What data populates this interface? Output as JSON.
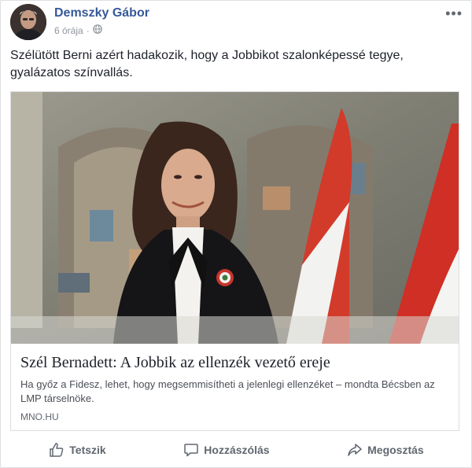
{
  "post": {
    "author": "Demszky Gábor",
    "time": "6 órája",
    "separator": "·",
    "message": "Szélütött Berni azért hadakozik, hogy a Jobbikot szalonképessé tegye, gyalázatos színvallás.",
    "more_label": "•••"
  },
  "link": {
    "title": "Szél Bernadett: A Jobbik az ellenzék vezető ereje",
    "description": "Ha győz a Fidesz, lehet, hogy megsemmisítheti a jelenlegi ellenzéket – mondta Bécsben az LMP társelnöke.",
    "domain": "MNO.HU"
  },
  "actions": {
    "like": "Tetszik",
    "comment": "Hozzászólás",
    "share": "Megosztás"
  },
  "icons": {
    "audience": "globe-icon",
    "like": "thumbs-up-icon",
    "comment": "comment-icon",
    "share": "share-icon",
    "more": "more-icon"
  },
  "colors": {
    "author": "#365899",
    "muted": "#90949c",
    "action_text": "#606770"
  }
}
